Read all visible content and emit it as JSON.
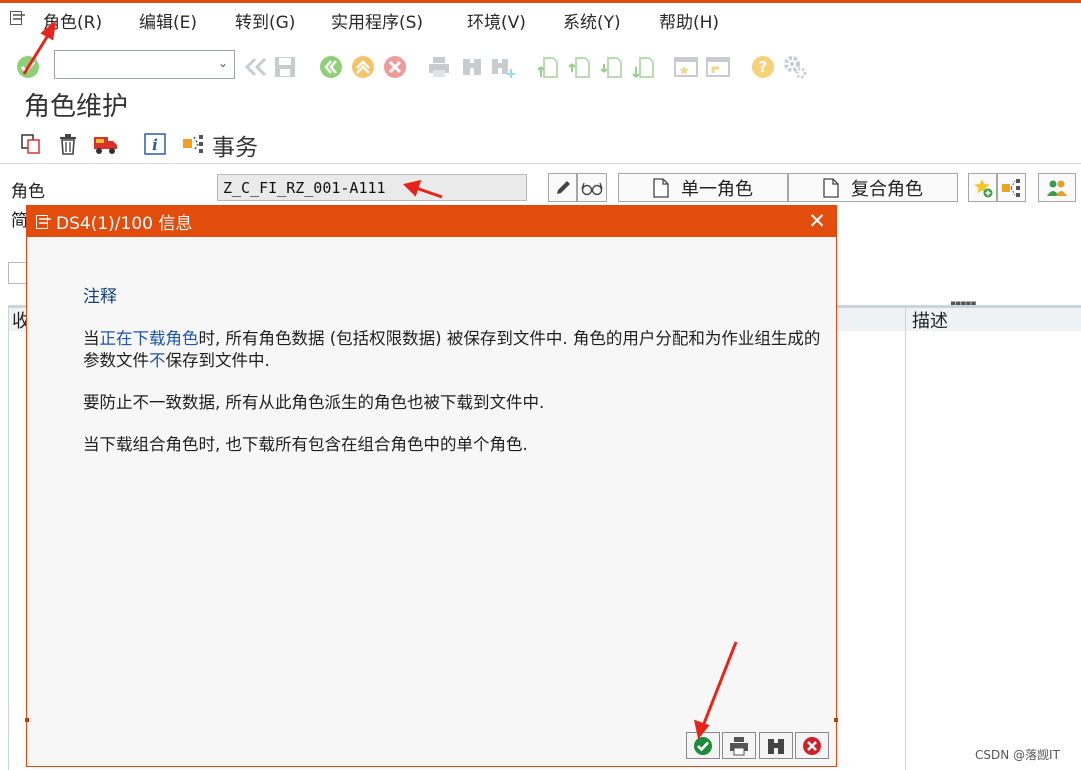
{
  "menu": {
    "items": [
      "角色(R)",
      "编辑(E)",
      "转到(G)",
      "实用程序(S)",
      "环境(V)",
      "系统(Y)",
      "帮助(H)"
    ]
  },
  "toolbar": {
    "command_value": "",
    "icons": [
      "confirm-icon",
      "prev-screen-icon",
      "save-icon",
      "back-icon",
      "exit-icon",
      "cancel-icon",
      "print-icon",
      "find-icon",
      "find-next-icon",
      "first-page-icon",
      "prev-page-icon",
      "next-page-icon",
      "last-page-icon",
      "create-session-icon",
      "shortcut-icon",
      "help-icon",
      "settings-icon"
    ]
  },
  "page": {
    "title": "角色维护",
    "transaction_label": "事务"
  },
  "role": {
    "label": "角色",
    "value": "Z_C_FI_RZ_001-A111",
    "single_role_button": "单一角色",
    "composite_role_button": "复合角色",
    "short_label": "简"
  },
  "background": {
    "col_left": "收",
    "col_desc": "描述"
  },
  "dialog": {
    "title": "DS4(1)/100 信息",
    "heading": "注释",
    "p1_a": "当",
    "p1_hl1": "正在下载角色",
    "p1_b": "时, 所有角色数据 (包括权限数据) 被保存到文件中. 角色的用户分配和为作业组生成的参数文件",
    "p1_hl2": "不",
    "p1_c": "保存到文件中.",
    "p2": "要防止不一致数据, 所有从此角色派生的角色也被下载到文件中.",
    "p3": "当下载组合角色时, 也下载所有包含在组合角色中的单个角色."
  },
  "watermark": "CSDN @落觊IT",
  "colors": {
    "accent": "#e24d0e",
    "link": "#1e56a8",
    "annotation_arrow": "#e8231a"
  }
}
